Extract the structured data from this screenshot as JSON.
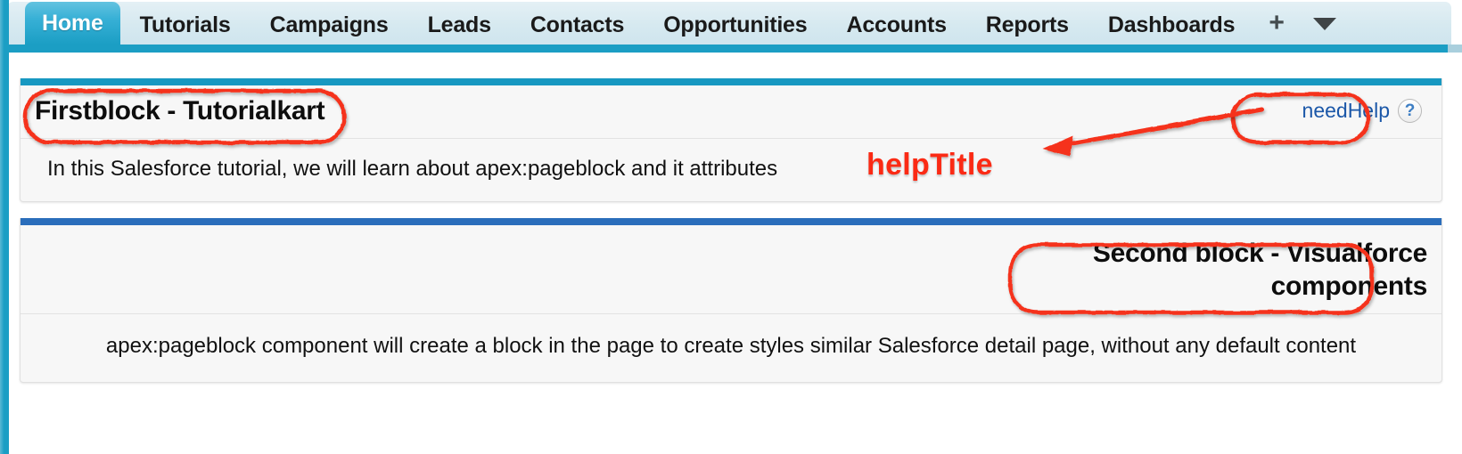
{
  "tabbar": {
    "tabs": [
      {
        "label": "Home",
        "active": true
      },
      {
        "label": "Tutorials",
        "active": false
      },
      {
        "label": "Campaigns",
        "active": false
      },
      {
        "label": "Leads",
        "active": false
      },
      {
        "label": "Contacts",
        "active": false
      },
      {
        "label": "Opportunities",
        "active": false
      },
      {
        "label": "Accounts",
        "active": false
      },
      {
        "label": "Reports",
        "active": false
      },
      {
        "label": "Dashboards",
        "active": false
      }
    ],
    "add_tab_icon": "plus-icon",
    "all_tabs_icon": "chevron-down-icon",
    "plus_glyph": "+",
    "underline_color": "#1b9ec4",
    "active_tab_color": "#1b9ec4",
    "background_color": "#d6e9f0"
  },
  "blocks": [
    {
      "id": "block1",
      "title": "Firstblock - Tutorialkart",
      "body": "In this Salesforce tutorial, we will learn about apex:pageblock and it attributes",
      "topbar_color": "#1798c1",
      "help": {
        "label": "needHelp",
        "icon_name": "help-question-icon",
        "icon_glyph": "?",
        "link_color": "#1b57a8"
      }
    },
    {
      "id": "block2",
      "title_line1": "Second block - Visualforce",
      "title_line2": "components",
      "body": "apex:pageblock component will create a block in the page to create styles similar Salesforce detail page, without any default content",
      "topbar_color": "#2a6dbb"
    }
  ],
  "annotations": {
    "color": "#fb2a14",
    "help_title_label": "helpTitle",
    "highlight_first_block_title": "Firstblock - Tutorialkart",
    "highlight_need_help": "needHelp",
    "highlight_second_block_title": "Second block - Visualforce components",
    "arrow_name": "help-title-pointer-arrow"
  },
  "page_edge": {
    "color": "#1b9ec4"
  }
}
